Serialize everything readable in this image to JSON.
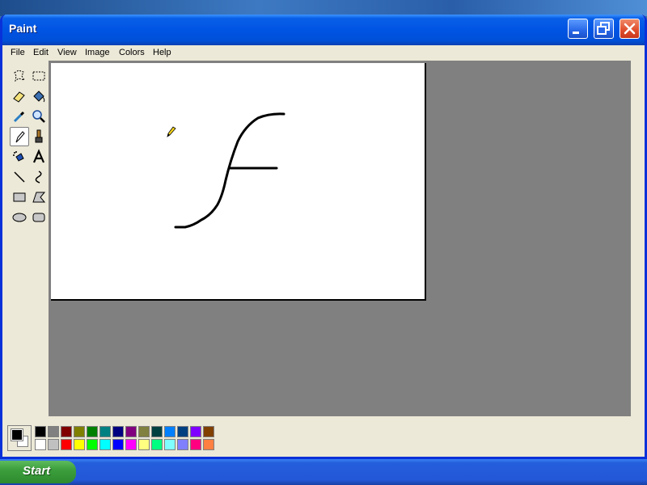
{
  "window": {
    "title": "Paint"
  },
  "menu": [
    "File",
    "Edit",
    "View",
    "Image",
    "Colors",
    "Help"
  ],
  "tools": [
    "free-form-select",
    "select",
    "eraser",
    "fill-with-color",
    "pick-color",
    "magnifier",
    "pencil",
    "brush",
    "airbrush",
    "text",
    "line",
    "curve",
    "rectangle",
    "polygon",
    "ellipse",
    "rounded-rectangle"
  ],
  "active_tool": "pencil",
  "colors": {
    "foreground": "#000000",
    "background": "#ffffff",
    "palette_top": [
      "#000000",
      "#808080",
      "#800000",
      "#808000",
      "#008000",
      "#008080",
      "#000080",
      "#800080",
      "#808040",
      "#004040",
      "#0080ff",
      "#004080",
      "#8000ff",
      "#804000"
    ],
    "palette_bottom": [
      "#ffffff",
      "#c0c0c0",
      "#ff0000",
      "#ffff00",
      "#00ff00",
      "#00ffff",
      "#0000ff",
      "#ff00ff",
      "#ffff80",
      "#00ff80",
      "#80ffff",
      "#8080ff",
      "#ff0080",
      "#ff8040"
    ]
  },
  "taskbar": {
    "start_label": "Start"
  }
}
